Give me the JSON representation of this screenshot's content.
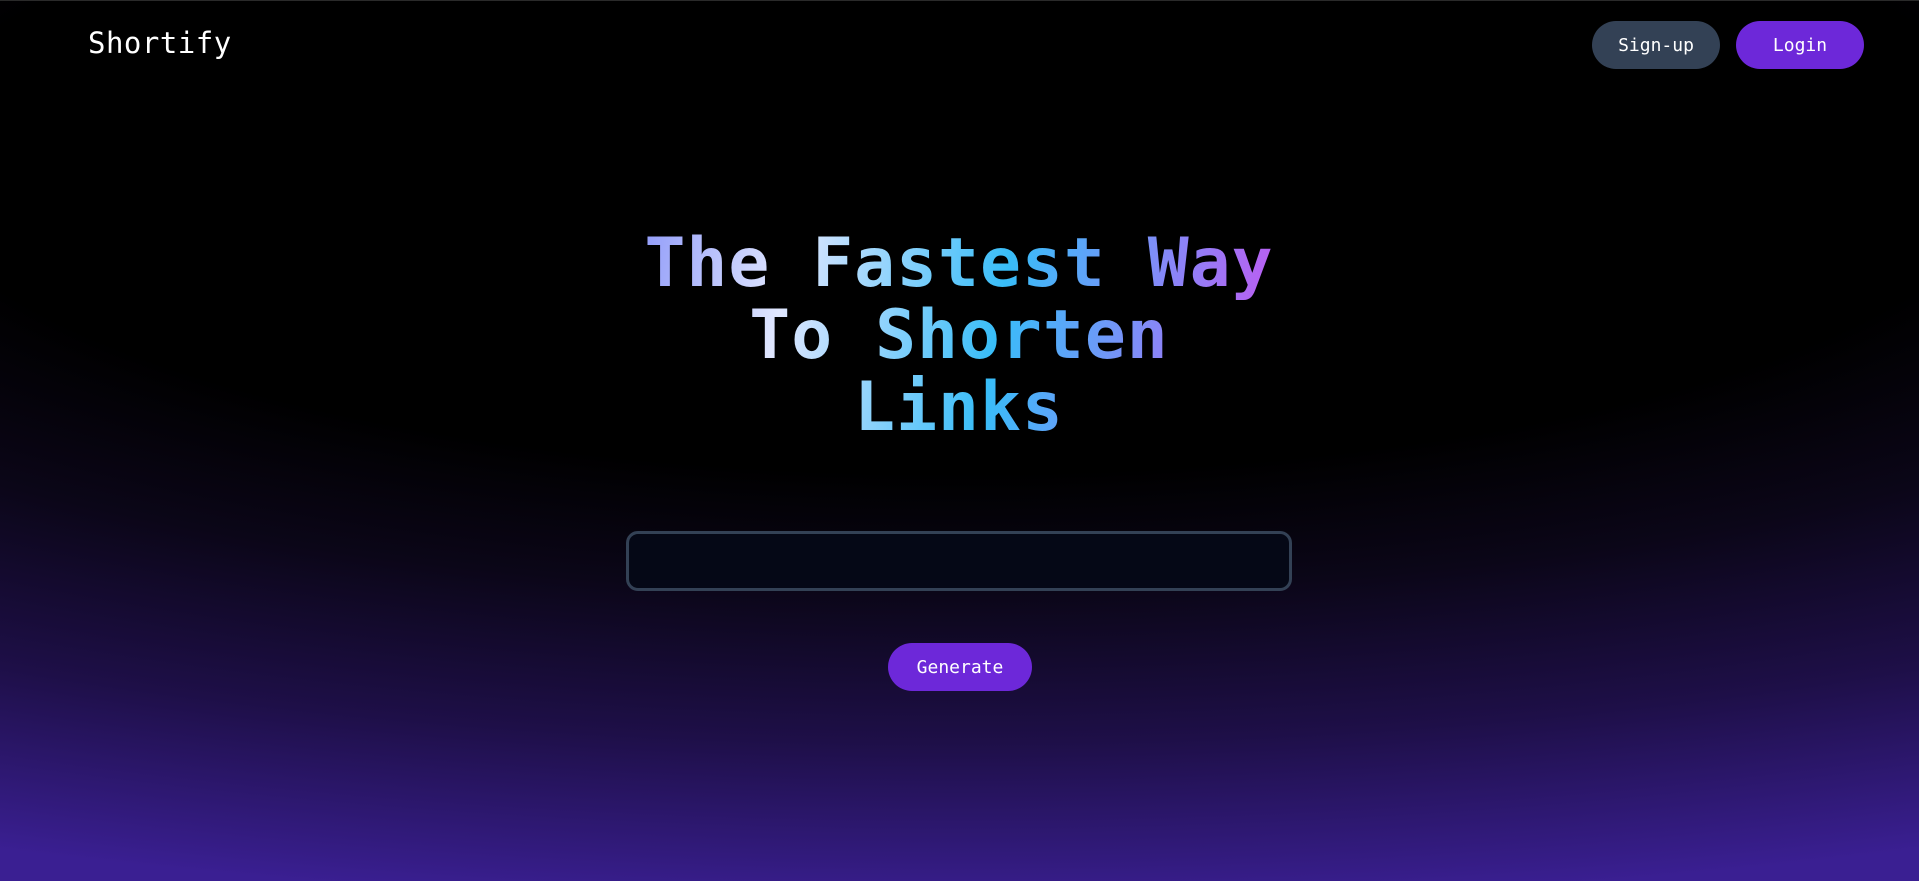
{
  "navbar": {
    "brand": "Shortify",
    "signup_label": "Sign-up",
    "login_label": "Login"
  },
  "hero": {
    "title_line1": "The Fastest Way",
    "title_line2": "To Shorten",
    "title_line3": "Links"
  },
  "form": {
    "url_value": "",
    "url_placeholder": "",
    "generate_label": "Generate"
  },
  "colors": {
    "accent": "#6d28d9",
    "secondary_button": "#334155",
    "input_background": "#050816",
    "input_border": "#334155",
    "background_top": "#000000",
    "background_bottom": "#3a1f92"
  }
}
